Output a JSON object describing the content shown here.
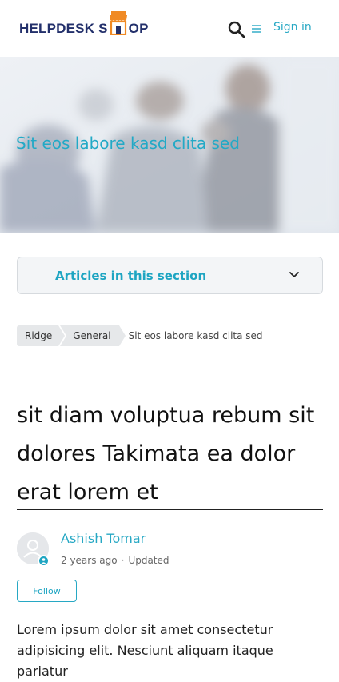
{
  "header": {
    "logo_left": "HELPDESK S",
    "logo_right": "OP",
    "signin_label": "Sign in"
  },
  "hero": {
    "title": "Sit eos labore kasd clita sed"
  },
  "section": {
    "label": "Articles in this section"
  },
  "breadcrumb": {
    "items": [
      "Ridge",
      "General"
    ],
    "current": "Sit eos labore kasd clita sed"
  },
  "article": {
    "title": "sit diam voluptua rebum sit dolores Takimata ea dolor erat lorem et",
    "author": "Ashish Tomar",
    "posted": "2 years ago",
    "separator": "·",
    "updated": "Updated",
    "follow_label": "Follow",
    "body": "Lorem ipsum dolor sit amet consectetur adipisicing elit. Nesciunt aliquam itaque pariatur"
  },
  "colors": {
    "accent": "#1ea5c2",
    "logo_navy": "#23306b",
    "logo_orange": "#f08a24"
  },
  "icons": {
    "search": "search-icon",
    "menu": "menu-icon",
    "chevron": "chevron-down-icon",
    "avatar": "avatar-icon",
    "badge": "user-badge-icon"
  }
}
